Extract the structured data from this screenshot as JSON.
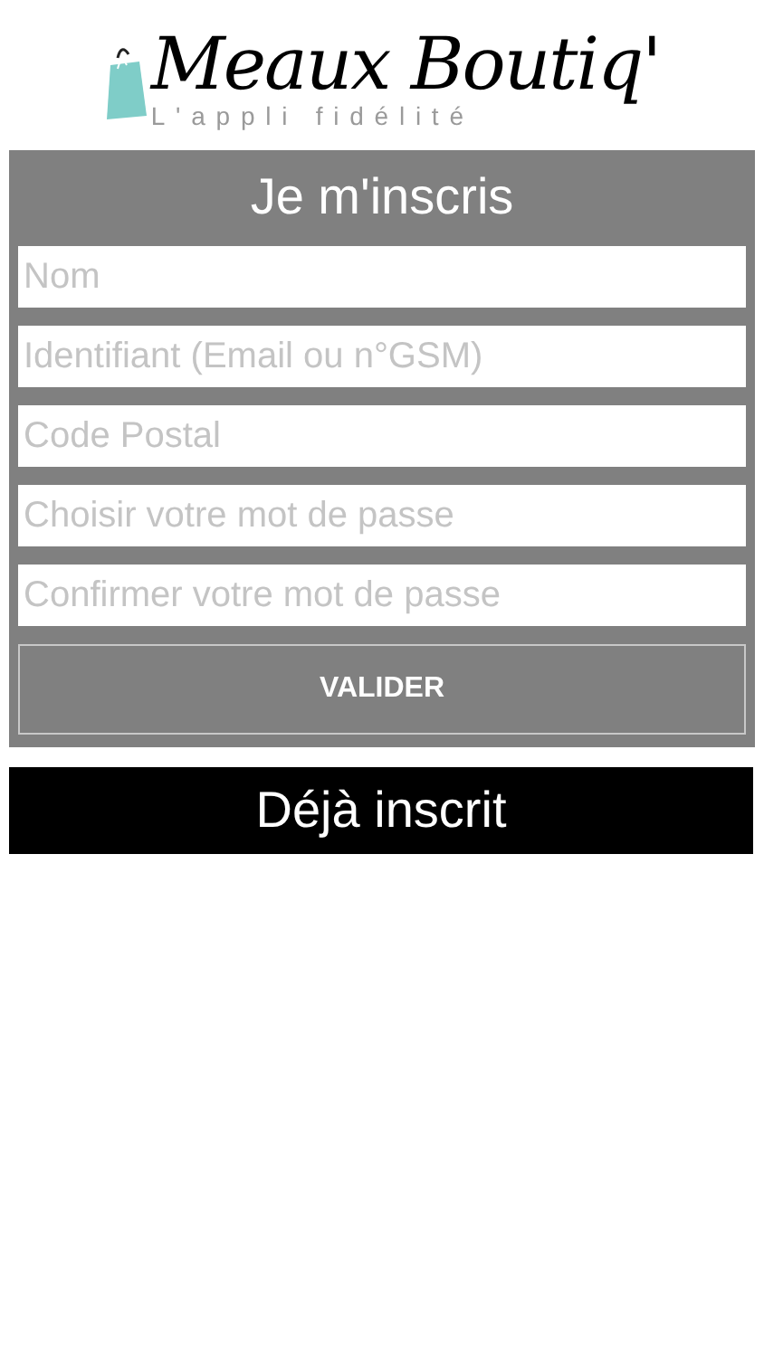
{
  "logo": {
    "name": "Meaux Boutiq'",
    "tagline": "L'appli fidélité"
  },
  "signup": {
    "title": "Je m'inscris",
    "fields": [
      {
        "placeholder": "Nom"
      },
      {
        "placeholder": "Identifiant (Email ou n°GSM)"
      },
      {
        "placeholder": "Code Postal"
      },
      {
        "placeholder": "Choisir votre mot de passe"
      },
      {
        "placeholder": "Confirmer votre mot de passe"
      }
    ],
    "submit": "VALIDER"
  },
  "login_button": "Déjà inscrit"
}
